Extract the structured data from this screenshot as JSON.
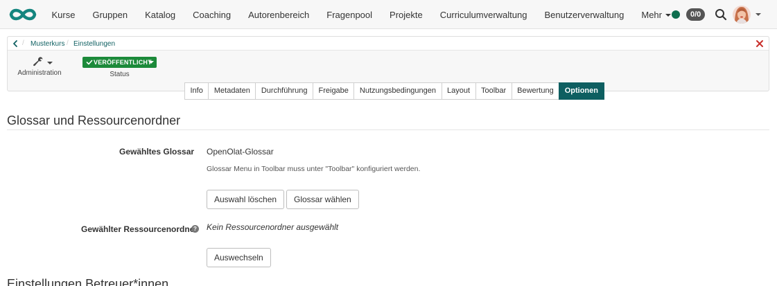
{
  "nav": {
    "items": [
      {
        "label": "Kurse"
      },
      {
        "label": "Gruppen"
      },
      {
        "label": "Katalog"
      },
      {
        "label": "Coaching"
      },
      {
        "label": "Autorenbereich"
      },
      {
        "label": "Fragenpool"
      },
      {
        "label": "Projekte"
      },
      {
        "label": "Curriculumverwaltung"
      },
      {
        "label": "Benutzerverwaltung"
      },
      {
        "label": "Mehr"
      }
    ],
    "count_badge": "0/0",
    "logo_icon": "infinity-logo-icon",
    "accent_color": "#0e6e4e"
  },
  "breadcrumb": {
    "items": [
      "Musterkurs",
      "Einstellungen"
    ]
  },
  "toolbar": {
    "admin_label": "Administration",
    "status_value": "VERÖFFENTLICHT",
    "status_label": "Status",
    "status_color": "#1c8a3a"
  },
  "tabs": [
    {
      "label": "Info"
    },
    {
      "label": "Metadaten"
    },
    {
      "label": "Durchführung"
    },
    {
      "label": "Freigabe"
    },
    {
      "label": "Nutzungsbedingungen"
    },
    {
      "label": "Layout"
    },
    {
      "label": "Toolbar"
    },
    {
      "label": "Bewertung"
    },
    {
      "label": "Optionen"
    }
  ],
  "active_tab": "Optionen",
  "tab_active_color": "#0e5f61",
  "glossary_section": {
    "title": "Glossar und Ressourcenordner",
    "glossary_label": "Gewähltes Glossar",
    "glossary_value": "OpenOlat-Glossar",
    "glossary_hint": "Glossar Menu in Toolbar muss unter \"Toolbar\" konfiguriert werden.",
    "clear_button": "Auswahl löschen",
    "choose_button": "Glossar wählen",
    "folder_label": "Gewählter Ressourcenordner",
    "folder_value": "Kein Ressourcenordner ausgewählt",
    "switch_button": "Auswechseln"
  },
  "coach_section": {
    "title": "Einstellungen Betreuer*innen"
  }
}
